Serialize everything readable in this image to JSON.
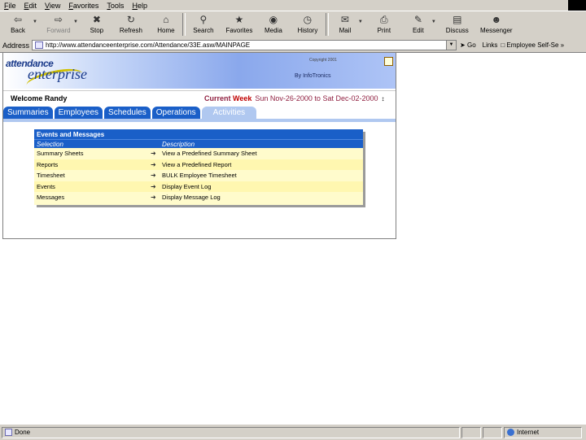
{
  "menu": [
    "File",
    "Edit",
    "View",
    "Favorites",
    "Tools",
    "Help"
  ],
  "toolbar": {
    "back": "Back",
    "forward": "Forward",
    "stop": "Stop",
    "refresh": "Refresh",
    "home": "Home",
    "search": "Search",
    "favorites": "Favorites",
    "media": "Media",
    "history": "History",
    "mail": "Mail",
    "print": "Print",
    "edit": "Edit",
    "discuss": "Discuss",
    "messenger": "Messenger"
  },
  "address": {
    "label": "Address",
    "url": "http://www.attendanceenterprise.com/Attendance/33E.asw/MAINPAGE",
    "go": "Go",
    "links": "Links",
    "links_item": "Employee Self-Se"
  },
  "header": {
    "logo_line1": "attendance",
    "logo_line2": "enterprise",
    "copyright": "Copyright 2001",
    "by": "By InfoTronics"
  },
  "welcome": {
    "text": "Welcome Randy",
    "current": "Current",
    "week": "Week",
    "range": "Sun Nov-26-2000 to Sat Dec-02-2000"
  },
  "tabs": [
    "Summaries",
    "Employees",
    "Schedules",
    "Operations",
    "Activities"
  ],
  "active_tab": "Activities",
  "panel": {
    "title": "Events and Messages",
    "col_selection": "Selection",
    "col_description": "Description",
    "rows": [
      {
        "selection": "Summary Sheets",
        "description": "View a Predefined Summary Sheet"
      },
      {
        "selection": "Reports",
        "description": "View a Predefined Report"
      },
      {
        "selection": "Timesheet",
        "description": "BULK Employee Timesheet"
      },
      {
        "selection": "Events",
        "description": "Display Event Log"
      },
      {
        "selection": "Messages",
        "description": "Display Message Log"
      }
    ]
  },
  "status": {
    "text": "Done",
    "zone": "Internet"
  },
  "colors": {
    "tab_blue": "#1a5fc8",
    "tab_active": "#b0c8f0",
    "panel_bg": "#fffbcc",
    "week_red": "#c00000"
  }
}
